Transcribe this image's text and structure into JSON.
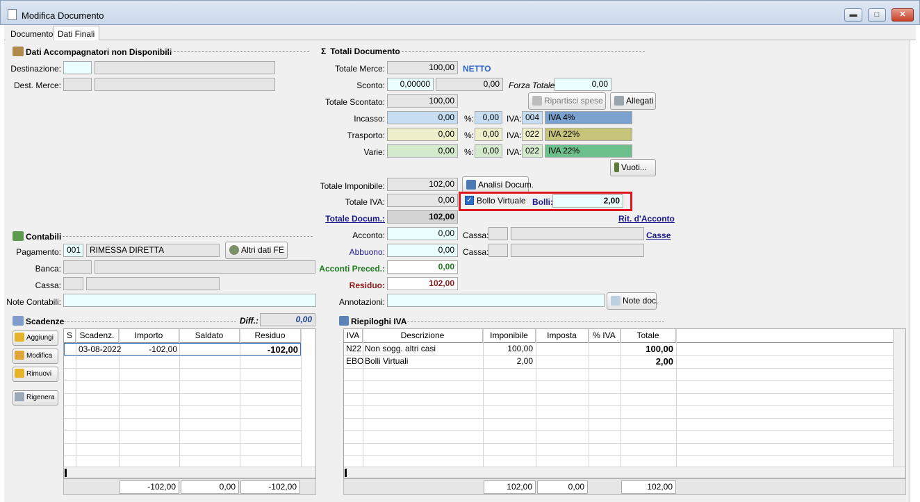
{
  "window": {
    "title": "Modifica Documento",
    "minimize": "▬",
    "maximize": "□",
    "close": "✕"
  },
  "tabs": [
    "Documento",
    "Dati Finali"
  ],
  "accompagnatori": {
    "title": "Dati Accompagnatori non Disponibili",
    "destinazione_label": "Destinazione:",
    "dest_merce_label": "Dest. Merce:"
  },
  "contabili": {
    "title": "Contabili",
    "pagamento_label": "Pagamento:",
    "pagamento_code": "001",
    "pagamento_desc": "RIMESSA DIRETTA",
    "altri_btn": "Altri dati FE",
    "banca_label": "Banca:",
    "cassa_label": "Cassa:",
    "note_label": "Note Contabili:"
  },
  "scadenze": {
    "title": "Scadenze",
    "diff_label": "Diff.:",
    "diff_value": "0,00",
    "buttons": [
      "Aggiungi",
      "Modifica",
      "Rimuovi",
      "Rigenera"
    ],
    "headers": [
      "S",
      "Scadenz.",
      "Importo",
      "Saldato",
      "Residuo"
    ],
    "rows": [
      {
        "s": "",
        "scadenza": "03-08-2022",
        "importo": "-102,00",
        "saldato": "",
        "residuo": "-102,00"
      }
    ],
    "totals": {
      "importo": "-102,00",
      "saldato": "0,00",
      "residuo": "-102,00"
    }
  },
  "totali": {
    "title": "Totali Documento",
    "totale_merce_label": "Totale Merce:",
    "totale_merce": "100,00",
    "netto": "NETTO",
    "sconto_label": "Sconto:",
    "sconto_pct": "0,00000",
    "sconto_val": "0,00",
    "forza_label": "Forza Totale:",
    "forza_val": "0,00",
    "totale_scontato_label": "Totale Scontato:",
    "totale_scontato": "100,00",
    "ripartisci": "Ripartisci spese",
    "allegati": "Allegati",
    "incasso_label": "Incasso:",
    "incasso": "0,00",
    "incasso_pct": "0,00",
    "incasso_iva": "004",
    "incasso_iva_desc": "IVA  4%",
    "trasporto_label": "Trasporto:",
    "trasporto": "0,00",
    "trasporto_pct": "0,00",
    "trasporto_iva": "022",
    "trasporto_iva_desc": "IVA 22%",
    "varie_label": "Varie:",
    "varie": "0,00",
    "varie_pct": "0,00",
    "varie_iva": "022",
    "varie_iva_desc": "IVA 22%",
    "pct_label": "%:",
    "iva_label": "IVA:",
    "vuoti": "Vuoti...",
    "imponibile_label": "Totale Imponibile:",
    "imponibile": "102,00",
    "analisi": "Analisi Docum.",
    "totale_iva_label": "Totale IVA:",
    "totale_iva": "0,00",
    "bollo_virtuale": "Bollo Virtuale",
    "bolli_label": "Bolli:",
    "bolli": "2,00",
    "totale_docum_label": "Totale Docum.:",
    "totale_docum": "102,00",
    "rit_acconto": "Rit. d'Acconto",
    "acconto_label": "Acconto:",
    "acconto": "0,00",
    "cassa_label": "Cassa:",
    "casse": "Casse",
    "abbuono_label": "Abbuono:",
    "abbuono": "0,00",
    "acconti_preced_label": "Acconti Preced.:",
    "acconti_preced": "0,00",
    "residuo_label": "Residuo:",
    "residuo": "102,00",
    "annotazioni_label": "Annotazioni:",
    "note_doc": "Note doc."
  },
  "riepiloghi": {
    "title": "Riepiloghi IVA",
    "headers": [
      "IVA",
      "Descrizione",
      "Imponibile",
      "Imposta",
      "% IVA",
      "Totale"
    ],
    "rows": [
      {
        "iva": "N22",
        "descrizione": "Non sogg. altri casi",
        "imponibile": "100,00",
        "imposta": "",
        "pct": "",
        "totale": "100,00"
      },
      {
        "iva": "EBO",
        "descrizione": "Bolli Virtuali",
        "imponibile": "2,00",
        "imposta": "",
        "pct": "",
        "totale": "2,00"
      }
    ],
    "totals": {
      "imponibile": "102,00",
      "imposta": "0,00",
      "totale": "102,00"
    }
  },
  "colors": {
    "incasso": "#c7def2",
    "trasporto": "#eeeeca",
    "varie": "#d3ebcc",
    "iva4": "#7ba1cf",
    "iva22_trasporto": "#c6c47b",
    "iva22_varie": "#6dbf8b",
    "highlight": "#e0161e",
    "netto": "#2a63c9"
  }
}
